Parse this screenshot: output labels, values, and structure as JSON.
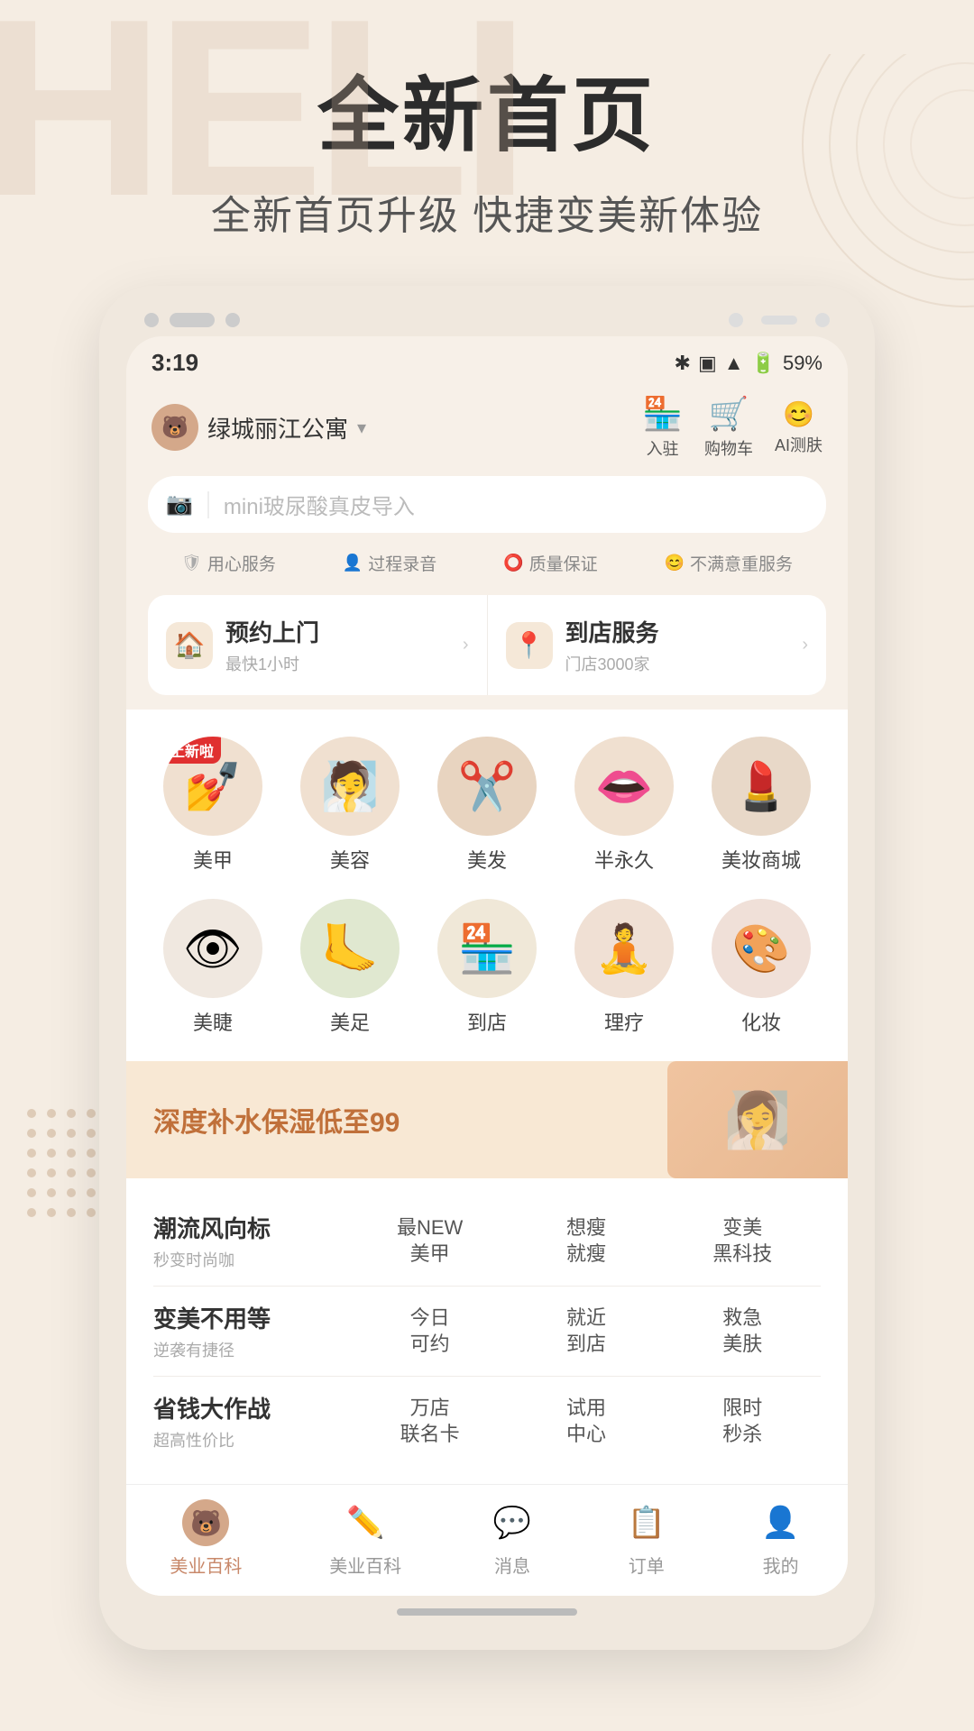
{
  "page": {
    "bg_text": "HELI",
    "main_title": "全新首页",
    "sub_title": "全新首页升级  快捷变美新体验"
  },
  "status_bar": {
    "time": "3:19",
    "battery": "59%"
  },
  "app_header": {
    "location": "绿城丽江公寓",
    "actions": [
      {
        "id": "checkin",
        "icon": "🏪",
        "label": "入驻"
      },
      {
        "id": "cart",
        "icon": "🛒",
        "label": "购物车"
      },
      {
        "id": "ai",
        "icon": "😊",
        "label": "AI测肤"
      }
    ]
  },
  "search": {
    "placeholder": "mini玻尿酸真皮导入",
    "icon": "📷"
  },
  "service_tags": [
    {
      "icon": "🛡",
      "label": "用心服务"
    },
    {
      "icon": "👤",
      "label": "过程录音"
    },
    {
      "icon": "⭕",
      "label": "质量保证"
    },
    {
      "icon": "😊",
      "label": "不满意重服务"
    }
  ],
  "quick_services": [
    {
      "id": "home_visit",
      "icon": "🏠",
      "title": "预约上门",
      "sub": "最快1小时",
      "has_arrow": true
    },
    {
      "id": "store_visit",
      "icon": "📍",
      "title": "到店服务",
      "sub": "门店3000家",
      "has_arrow": true
    }
  ],
  "categories": [
    {
      "row": 1,
      "items": [
        {
          "id": "nail",
          "emoji": "💅",
          "label": "美甲",
          "is_new": true
        },
        {
          "id": "beauty",
          "emoji": "🧖",
          "label": "美容",
          "is_new": false
        },
        {
          "id": "hair",
          "emoji": "✂️",
          "label": "美发",
          "is_new": false
        },
        {
          "id": "semi_perm",
          "emoji": "👄",
          "label": "半永久",
          "is_new": false
        },
        {
          "id": "makeup_mall",
          "emoji": "💄",
          "label": "美妆商城",
          "is_new": false
        }
      ]
    },
    {
      "row": 2,
      "items": [
        {
          "id": "lash",
          "emoji": "👁",
          "label": "美睫",
          "is_new": false
        },
        {
          "id": "foot",
          "emoji": "🦶",
          "label": "美足",
          "is_new": false
        },
        {
          "id": "store",
          "emoji": "🏪",
          "label": "到店",
          "is_new": false
        },
        {
          "id": "therapy",
          "emoji": "🧘",
          "label": "理疗",
          "is_new": false
        },
        {
          "id": "makeup",
          "emoji": "🎨",
          "label": "化妆",
          "is_new": false
        }
      ]
    }
  ],
  "banner": {
    "text": "深度补水保湿低至99"
  },
  "menu_rows": [
    {
      "title": "潮流风向标",
      "sub": "秒变时尚咖",
      "items": [
        {
          "lines": [
            "最NEW",
            "美甲"
          ]
        },
        {
          "lines": [
            "想瘦",
            "就瘦"
          ]
        },
        {
          "lines": [
            "变美",
            "黑科技"
          ]
        }
      ]
    },
    {
      "title": "变美不用等",
      "sub": "逆袭有捷径",
      "items": [
        {
          "lines": [
            "今日",
            "可约"
          ]
        },
        {
          "lines": [
            "就近",
            "到店"
          ]
        },
        {
          "lines": [
            "救急",
            "美肤"
          ]
        }
      ]
    },
    {
      "title": "省钱大作战",
      "sub": "超高性价比",
      "items": [
        {
          "lines": [
            "万店",
            "联名卡"
          ]
        },
        {
          "lines": [
            "试用",
            "中心"
          ]
        },
        {
          "lines": [
            "限时",
            "秒杀"
          ]
        }
      ]
    }
  ],
  "bottom_nav": [
    {
      "id": "home",
      "label": "美业百科",
      "active": true,
      "icon_type": "avatar"
    },
    {
      "id": "encyclopedia",
      "label": "美业百科",
      "active": false,
      "icon": "✏️"
    },
    {
      "id": "message",
      "label": "消息",
      "active": false,
      "icon": "💬"
    },
    {
      "id": "orders",
      "label": "订单",
      "active": false,
      "icon": "📋"
    },
    {
      "id": "mine",
      "label": "我的",
      "active": false,
      "icon": "👤"
    }
  ],
  "new_badge_text": "上新啦"
}
